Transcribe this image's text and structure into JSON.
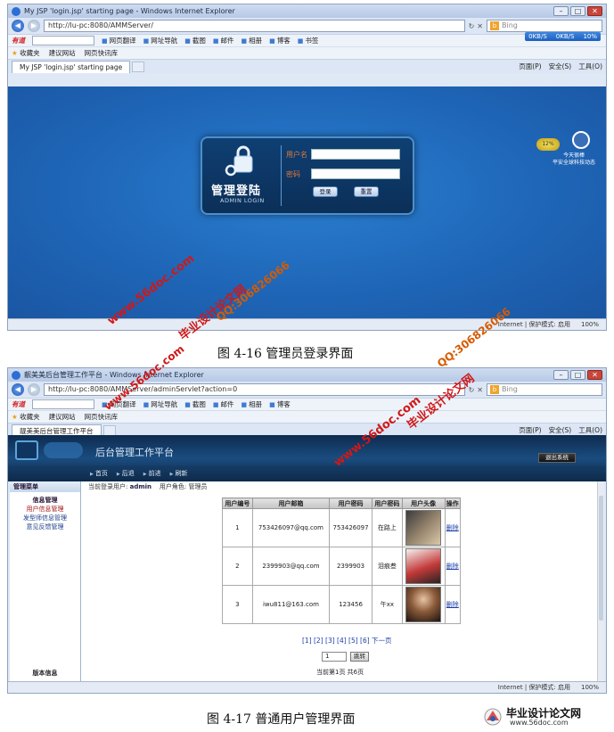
{
  "figure1": {
    "window_title": "My JSP 'login.jsp' starting page - Windows Internet Explorer",
    "address": "http://lu-pc:8080/AMMServer/",
    "search_placeholder": "Bing",
    "speed_down": "0KB/S",
    "speed_up": "0KB/S",
    "speed_pct": "10%",
    "toolbar_logo": "有道",
    "toolbar_items": [
      "网页翻译",
      "网址导航",
      "截图",
      "邮件",
      "相册",
      "博客",
      "书签"
    ],
    "fav_label": "收藏夹",
    "fav_items": [
      "建议网站",
      "网页快讯库"
    ],
    "tab_title": "My JSP 'login.jsp' starting page",
    "cmd_items": [
      "页面(P)",
      "安全(S)",
      "工具(O)"
    ],
    "login": {
      "title": "管理登陆",
      "subtitle": "ADMIN LOGIN",
      "username_label": "用户名",
      "password_label": "密码",
      "login_button": "登录",
      "reset_button": "重置"
    },
    "widget_badge": "12%",
    "widget_lines": [
      "今天很棒",
      "平安全球科技动态"
    ],
    "status_zone": "Internet | 保护模式: 启用",
    "status_zoom": "100%",
    "caption": "图 4-16   管理员登录界面"
  },
  "figure2": {
    "window_title": "靓美美后台管理工作平台 - Windows Internet Explorer",
    "address": "http://lu-pc:8080/AMMServer/adminServlet?action=0",
    "tab_title": "靓美美后台管理工作平台",
    "header_title": "后台管理工作平台",
    "logout_button": "退出系统",
    "nav_items": [
      "首页",
      "后退",
      "前进",
      "刷新"
    ],
    "sidebar": {
      "header": "管理菜单",
      "group": "信息管理",
      "items": [
        "用户信息管理",
        "发型师信息管理",
        "意见反馈管理"
      ],
      "footer": "版本信息"
    },
    "crumb_user_label": "当前登录用户:",
    "crumb_user": "admin",
    "crumb_role_label": "用户角色:",
    "crumb_role": "管理员",
    "table": {
      "headers": [
        "用户编号",
        "用户邮箱",
        "用户密码",
        "用户密码",
        "用户头像",
        "操作"
      ],
      "rows": [
        {
          "id": "1",
          "email": "753426097@qq.com",
          "password": "753426097",
          "nickname": "在路上",
          "action": "删除"
        },
        {
          "id": "2",
          "email": "2399903@qq.com",
          "password": "2399903",
          "nickname": "泪痕叁",
          "action": "删除"
        },
        {
          "id": "3",
          "email": "iwu811@163.com",
          "password": "123456",
          "nickname": "午xx",
          "action": "删除"
        }
      ]
    },
    "pager": "[1] [2] [3] [4] [5] [6] 下一页",
    "jump_value": "1",
    "jump_button": "跳转",
    "page_info": "当前第1页  共6页",
    "status_zone": "Internet | 保护模式: 启用",
    "status_zoom": "100%",
    "caption": "图 4-17   普通用户管理界面"
  },
  "watermarks": {
    "site": "www.56doc.com",
    "qq": "QQ:306826066",
    "name": "毕业设计论文网"
  },
  "footer_logo": {
    "name": "毕业设计论文网",
    "url": "www.56doc.com"
  }
}
